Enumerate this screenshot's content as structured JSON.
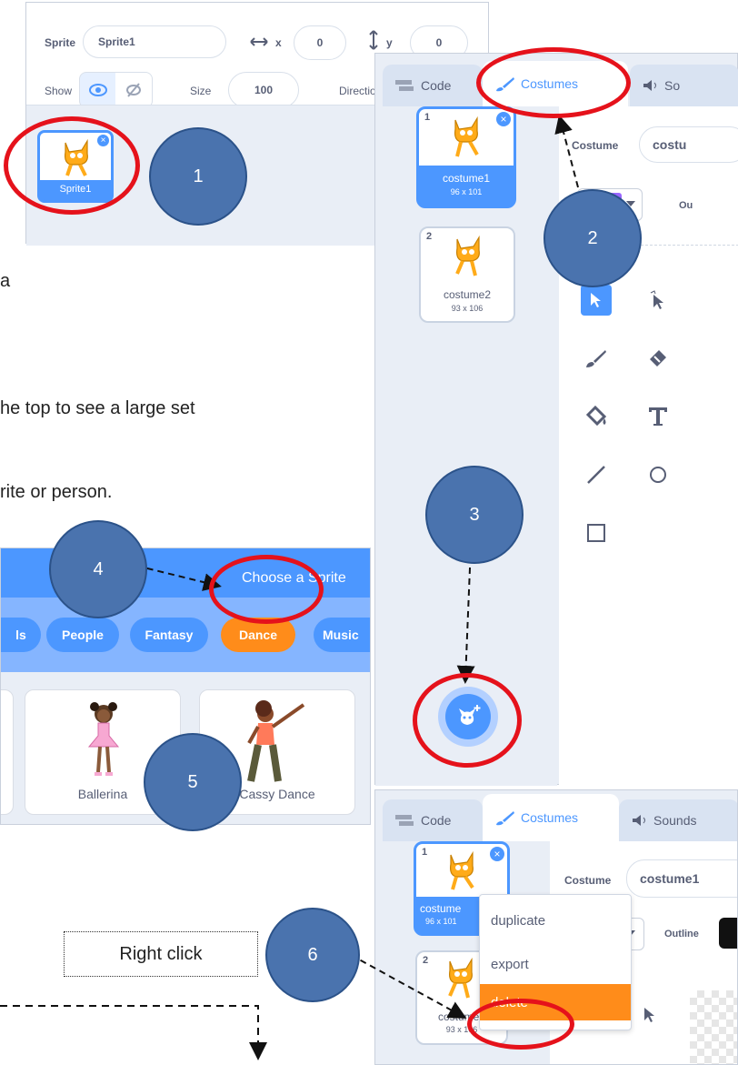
{
  "sprite_panel": {
    "sprite_label": "Sprite",
    "sprite_name": "Sprite1",
    "x_label": "x",
    "x_value": "0",
    "y_label": "y",
    "y_value": "0",
    "show_label": "Show",
    "size_label": "Size",
    "size_value": "100",
    "direction_label": "Directio",
    "thumb_name": "Sprite1"
  },
  "editor_top": {
    "tabs": {
      "code": "Code",
      "costumes": "Costumes",
      "sounds": "So"
    },
    "costume_label": "Costume",
    "costume_value": "costu",
    "outline_label": "Ou",
    "costumes": [
      {
        "num": "1",
        "name": "costume1",
        "dims": "96 x 101"
      },
      {
        "num": "2",
        "name": "costume2",
        "dims": "93 x 106"
      }
    ]
  },
  "body_text": {
    "line1": "a",
    "line2": "he top to see a large set",
    "line3": "rite or person."
  },
  "sprite_library": {
    "title": "Choose a Sprite",
    "categories": [
      "ls",
      "People",
      "Fantasy",
      "Dance",
      "Music"
    ],
    "sprites": [
      "Ballerina",
      "Cassy Dance"
    ]
  },
  "editor_bottom": {
    "tabs": {
      "code": "Code",
      "costumes": "Costumes",
      "sounds": "Sounds"
    },
    "costume_label": "Costume",
    "costume_value": "costume1",
    "outline_label": "Outline",
    "costumes": [
      {
        "num": "1",
        "name": "costume",
        "dims": "96 x 101"
      },
      {
        "num": "2",
        "name": "costume2",
        "dims": "93 x 106"
      }
    ],
    "context_menu": [
      "duplicate",
      "export",
      "delete"
    ]
  },
  "callouts": {
    "step1": "1",
    "step2": "2",
    "step3": "3",
    "step4": "4",
    "step5": "5",
    "step6": "6",
    "right_click": "Right click"
  },
  "colors": {
    "scratch_blue": "#4c97ff",
    "highlight_red": "#e5121b",
    "badge_blue": "#4a73ae",
    "dance_orange": "#ff8c1a"
  }
}
